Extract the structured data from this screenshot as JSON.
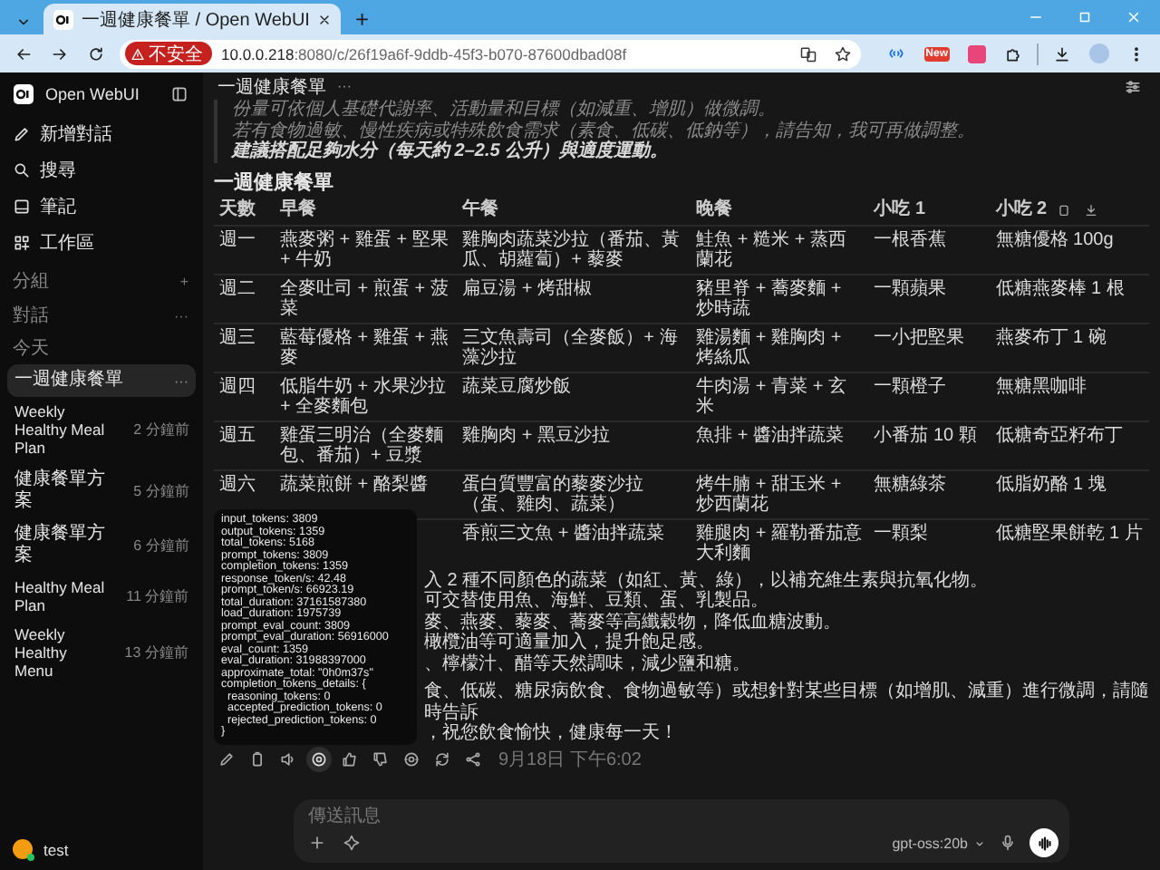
{
  "browser": {
    "tab_title": "一週健康餐單 / Open WebUI",
    "new_tab": "+",
    "security_badge": "不安全",
    "url_host": "10.0.0.218",
    "url_rest": ":8080/c/26f19a6f-9ddb-45f3-b070-87600dbad08f",
    "extension_badge": "New"
  },
  "sidebar": {
    "app_name": "Open WebUI",
    "nav": [
      {
        "kind": "pencil",
        "label": "新增對話"
      },
      {
        "kind": "search",
        "label": "搜尋"
      },
      {
        "kind": "note",
        "label": "筆記"
      },
      {
        "kind": "grid",
        "label": "工作區"
      }
    ],
    "sections": [
      {
        "label": "分組",
        "action": "+"
      },
      {
        "label": "對話",
        "action": "···"
      }
    ],
    "group_label": "今天",
    "chats": [
      {
        "title": "一週健康餐單",
        "more": "···",
        "selected": true
      },
      {
        "title": "Weekly Healthy Meal Plan",
        "time": "2 分鐘前",
        "selected": false
      },
      {
        "title": "健康餐單方案",
        "time": "5 分鐘前",
        "selected": false
      },
      {
        "title": "健康餐單方案",
        "time": "6 分鐘前",
        "selected": false
      },
      {
        "title": "Healthy Meal Plan",
        "time": "11 分鐘前",
        "selected": false
      },
      {
        "title": "Weekly Healthy Menu",
        "time": "13 分鐘前",
        "selected": false
      }
    ],
    "user": {
      "name": "test"
    }
  },
  "chat": {
    "title": "一週健康餐單",
    "title_menu": "···",
    "notes": [
      {
        "text": "份量可依個人基礎代謝率、活動量和目標（如減重、增肌）做微調。",
        "strong": false
      },
      {
        "text": "若有食物過敏、慢性疾病或特殊飲食需求（素食、低碳、低鈉等），請告知，我可再做調整。",
        "strong": false
      },
      {
        "text": "建議搭配足夠水分（每天約 2–2.5 公升）與適度運動。",
        "strong": true
      }
    ],
    "heading": "一週健康餐單",
    "table": {
      "columns": [
        "天數",
        "早餐",
        "午餐",
        "晚餐",
        "小吃 1",
        "小吃 2"
      ],
      "rows": [
        [
          "週一",
          "燕麥粥 + 雞蛋 + 堅果 + 牛奶",
          "雞胸肉蔬菜沙拉（番茄、黃瓜、胡蘿蔔）+ 藜麥",
          "鮭魚 + 糙米 + 蒸西蘭花",
          "一根香蕉",
          "無糖優格 100g"
        ],
        [
          "週二",
          "全麥吐司 + 煎蛋 + 菠菜",
          "扁豆湯 + 烤甜椒",
          "豬里脊 + 蕎麥麵 + 炒時蔬",
          "一顆蘋果",
          "低糖燕麥棒 1 根"
        ],
        [
          "週三",
          "藍莓優格 + 雞蛋 + 燕麥",
          "三文魚壽司（全麥飯）+ 海藻沙拉",
          "雞湯麵 + 雞胸肉 + 烤絲瓜",
          "一小把堅果",
          "燕麥布丁 1 碗"
        ],
        [
          "週四",
          "低脂牛奶 + 水果沙拉 + 全麥麵包",
          "蔬菜豆腐炒飯",
          "牛肉湯 + 青菜 + 玄米",
          "一顆橙子",
          "無糖黑咖啡"
        ],
        [
          "週五",
          "雞蛋三明治（全麥麵包、番茄）+ 豆漿",
          "雞胸肉 + 黑豆沙拉",
          "魚排 + 醬油拌蔬菜",
          "小番茄 10 顆",
          "低糖奇亞籽布丁"
        ],
        [
          "週六",
          "蔬菜煎餅 + 酪梨醬",
          "蛋白質豐富的藜麥沙拉（蛋、雞肉、蔬菜）",
          "烤牛腩 + 甜玉米 + 炒西蘭花",
          "無糖綠茶",
          "低脂奶酪 1 塊"
        ],
        [
          "",
          "",
          "香煎三文魚 + 醬油拌蔬菜",
          "雞腿肉 + 羅勒番茄意大利麵",
          "一顆梨",
          "低糖堅果餅乾 1 片"
        ]
      ]
    },
    "paragraph_lines": [
      "入 2 種不同顏色的蔬菜（如紅、黃、綠），以補充維生素與抗氧化物。",
      "可交替使用魚、海鮮、豆類、蛋、乳製品。",
      "麥、燕麥、藜麥、蕎麥等高纖穀物，降低血糖波動。",
      "橄欖油等可適量加入，提升飽足感。",
      "、檸檬汁、醋等天然調味，減少鹽和糖。",
      "食、低碳、糖尿病飲食、食物過敏等）或想針對某些目標（如增肌、減重）進行微調，請隨時告訴",
      "，祝您飲食愉快，健康每一天！"
    ],
    "tooltip_lines": [
      "input_tokens: 3809",
      "output_tokens: 1359",
      "total_tokens: 5168",
      "prompt_tokens: 3809",
      "completion_tokens: 1359",
      "response_token/s: 42.48",
      "prompt_token/s: 66923.19",
      "total_duration: 37161587380",
      "load_duration: 1975739",
      "prompt_eval_count: 3809",
      "prompt_eval_duration: 56916000",
      "eval_count: 1359",
      "eval_duration: 31988397000",
      "approximate_total: \"0h0m37s\"",
      "completion_tokens_details: {",
      "  reasoning_tokens: 0",
      "  accepted_prediction_tokens: 0",
      "  rejected_prediction_tokens: 0",
      "}"
    ],
    "actions": [
      {
        "kind": "edit",
        "selected": false
      },
      {
        "kind": "copy",
        "selected": false
      },
      {
        "kind": "speak",
        "selected": false
      },
      {
        "kind": "info",
        "selected": true
      },
      {
        "kind": "like",
        "selected": false
      },
      {
        "kind": "dislike",
        "selected": false
      },
      {
        "kind": "eye",
        "selected": false
      },
      {
        "kind": "regenerate",
        "selected": false
      },
      {
        "kind": "share",
        "selected": false
      }
    ],
    "timestamp": "9月18日 下午6:02"
  },
  "input": {
    "placeholder": "傳送訊息",
    "model": "gpt-oss:20b"
  }
}
